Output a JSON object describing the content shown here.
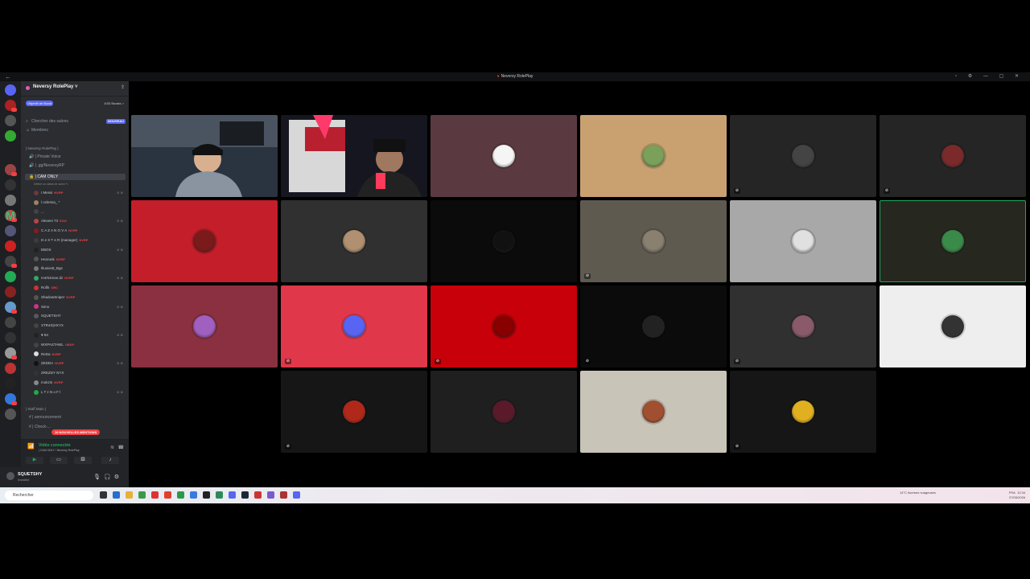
{
  "window": {
    "title": "Neversy RolePlay",
    "back": "←",
    "controls": "▫ ⚙ — ▢ ✕"
  },
  "guild": {
    "name": "Neversy RolePlay ˅",
    "boost_goal": "Objectif de Boost",
    "boost_count": "4/33 Boosts >"
  },
  "nav": {
    "search_channels": "Chercher des salons",
    "new_badge": "NOUVEAU",
    "members": "Membres"
  },
  "categories": {
    "neversy": "| Neversy RolePlay |",
    "staff": "| Staff Main |"
  },
  "channels": {
    "private_voice": "| Private Voice",
    "gg": "| .gg/NeversyRP",
    "cam_only": "| CAM ONLY",
    "cam_only_sub": "Définir un statut de salon ✎",
    "announcement": "| announcement",
    "check": "| Check-..."
  },
  "members": [
    {
      "name": "I Messi",
      "tag": "NVRP",
      "color": "#6b3a3a"
    },
    {
      "name": "l ozlemia_ *",
      "tag": "",
      "color": "#a08060"
    },
    {
      "name": "...",
      "tag": "",
      "color": "#444"
    },
    {
      "name": "Alexeei 73",
      "tag": "EGG",
      "color": "#b44"
    },
    {
      "name": "C A Z A N O V A",
      "tag": "NVRP",
      "color": "#8b1a1a"
    },
    {
      "name": "D e X T e R (manager)",
      "tag": "NVRP",
      "color": "#3c3c3c"
    },
    {
      "name": "EBOS",
      "tag": "",
      "color": "#222"
    },
    {
      "name": "Hexrunk",
      "tag": "NVRP",
      "color": "#555"
    },
    {
      "name": "Illusion8_Bgs",
      "tag": "",
      "color": "#777"
    },
    {
      "name": "m4rk4man.dz",
      "tag": "NVRP",
      "color": "#3a6"
    },
    {
      "name": "Rofik",
      "tag": "OBC",
      "color": "#c33"
    },
    {
      "name": "ShadowSniper",
      "tag": "NVRP",
      "color": "#555"
    },
    {
      "name": "Simo",
      "tag": "",
      "color": "#c38"
    },
    {
      "name": "SQUETSHY",
      "tag": "",
      "color": "#56585f"
    },
    {
      "name": "XTR4S|HXYX",
      "tag": "",
      "color": "#444"
    },
    {
      "name": "♥ 84",
      "tag": "",
      "color": "#222"
    },
    {
      "name": "WXPASTAWL",
      "tag": "OBSP",
      "color": "#444"
    },
    {
      "name": "ReDa",
      "tag": "NVRP",
      "color": "#ddd"
    },
    {
      "name": "ZEDDA",
      "tag": "NVRP",
      "color": "#111"
    },
    {
      "name": "ZREZDY NYX",
      "tag": "",
      "color": "#333"
    },
    {
      "name": "mokzin",
      "tag": "NVRP",
      "color": "#888"
    },
    {
      "name": "L T z N o F l",
      "tag": "",
      "color": "#2a4"
    }
  ],
  "mentions": "10 NOUVELLES MENTIONS",
  "voice": {
    "status": "Vidéo connectée",
    "location": "| CAM ONLY / Neversy RolePlay"
  },
  "user": {
    "name": "SQUETSHY",
    "status": "Invisible"
  },
  "tiles": [
    {
      "bg": "#2a3440",
      "camera": true,
      "avatar": ""
    },
    {
      "bg": "#1a1a2a",
      "camera": true,
      "avatar": ""
    },
    {
      "bg": "#5a3a40",
      "avatar": "#f5f5f5",
      "muted": false
    },
    {
      "bg": "#c9a070",
      "avatar": "#7ba05a",
      "muted": false
    },
    {
      "bg": "#252525",
      "avatar": "#444",
      "muted": true
    },
    {
      "bg": "#252525",
      "avatar": "#7a2a2a",
      "muted": true
    },
    {
      "bg": "#c41e2a",
      "avatar": "#7a1a1a",
      "muted": false
    },
    {
      "bg": "#303030",
      "avatar": "#b09070",
      "muted": false
    },
    {
      "bg": "#0b0b0b",
      "avatar": "#111",
      "muted": false
    },
    {
      "bg": "#5e5a50",
      "avatar": "#8a8070",
      "muted": true
    },
    {
      "bg": "#a8a8a8",
      "avatar": "#e0e0e0",
      "muted": false
    },
    {
      "bg": "#262820",
      "avatar": "#3a8a4a",
      "muted": false,
      "speaking": true
    },
    {
      "bg": "#8a3040",
      "avatar": "#a060c0",
      "muted": false
    },
    {
      "bg": "#e0384a",
      "avatar": "#5865f2",
      "muted": true
    },
    {
      "bg": "#c8000a",
      "avatar": "#800",
      "muted": true
    },
    {
      "bg": "#0b0b0b",
      "avatar": "#222",
      "muted": true
    },
    {
      "bg": "#303030",
      "avatar": "#8a5a6a",
      "muted": true
    },
    {
      "bg": "#eeeeee",
      "avatar": "#333",
      "muted": false
    },
    {
      "bg": "#000000",
      "empty": true
    },
    {
      "bg": "#161616",
      "avatar": "#b0281a",
      "muted": true
    },
    {
      "bg": "#1f1f1f",
      "avatar": "#5a1a2a",
      "muted": false
    },
    {
      "bg": "#c8c4b8",
      "avatar": "#a05030",
      "muted": false
    },
    {
      "bg": "#161616",
      "avatar": "#e0b020",
      "muted": true
    }
  ],
  "taskbar": {
    "search": "Rechercher",
    "weather": "14°C\nAverses nuageuses",
    "tray": "FRA",
    "time": "12:34",
    "date": "27/05/2026"
  }
}
